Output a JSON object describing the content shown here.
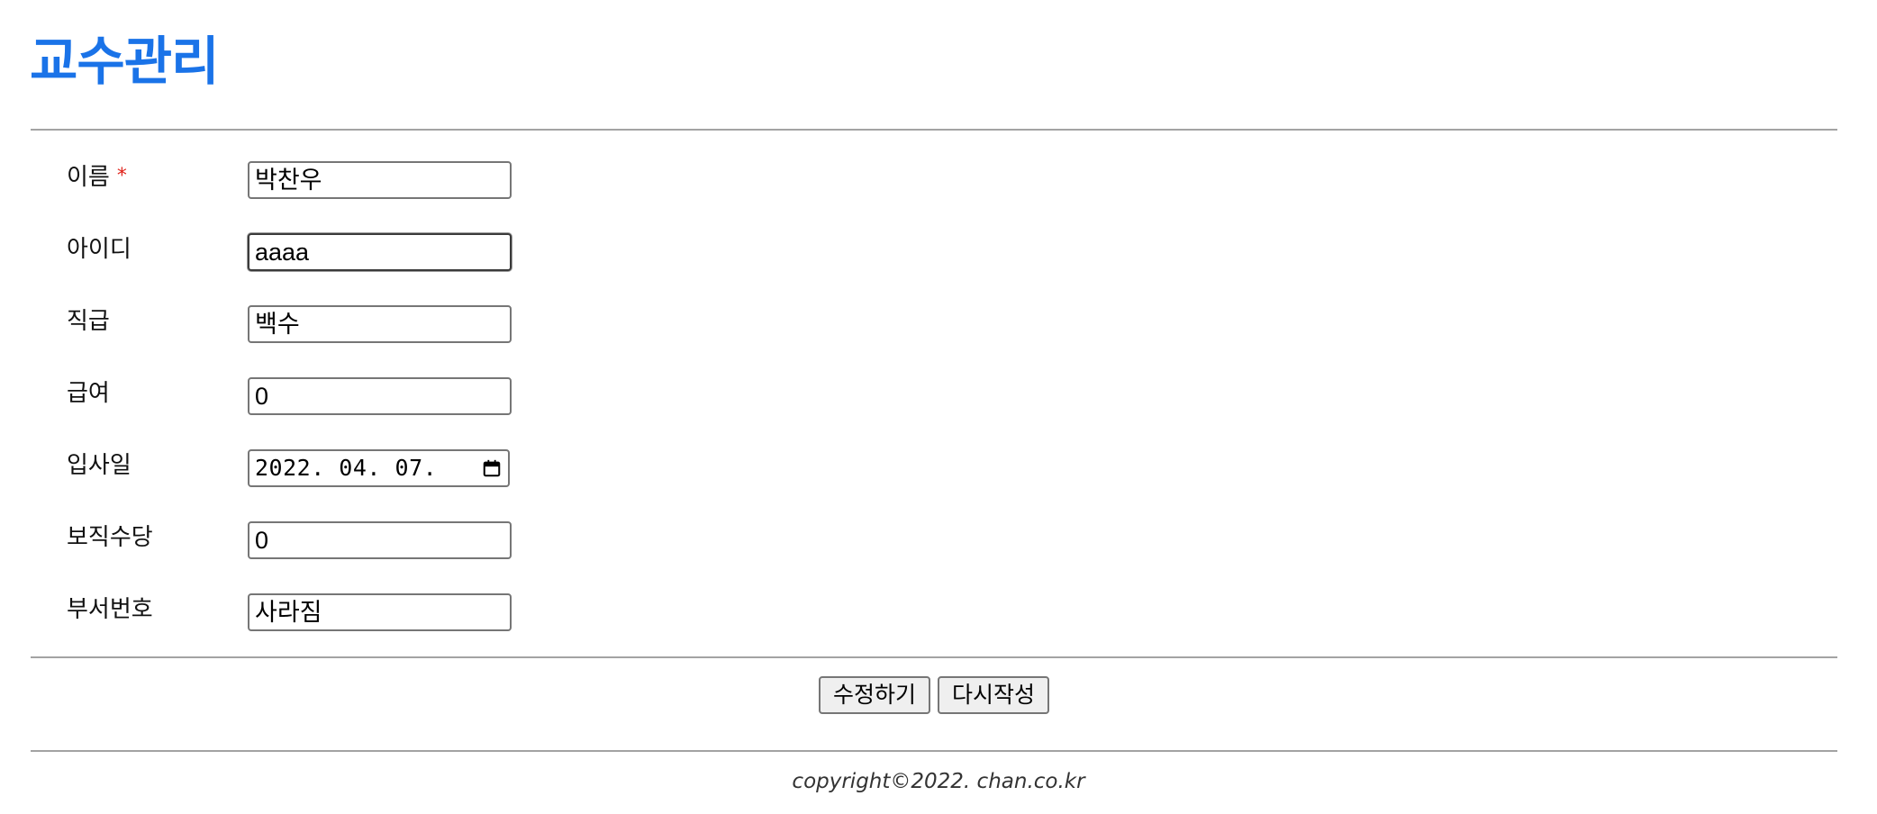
{
  "page": {
    "title": "교수관리"
  },
  "form": {
    "required_mark": "*",
    "fields": [
      {
        "label": "이름",
        "value": "박찬우",
        "required": true
      },
      {
        "label": "아이디",
        "value": "aaaa"
      },
      {
        "label": "직급",
        "value": "백수"
      },
      {
        "label": "급여",
        "value": "0"
      },
      {
        "label": "입사일",
        "value": "2022. 04. 07.",
        "type": "date"
      },
      {
        "label": "보직수당",
        "value": "0"
      },
      {
        "label": "부서번호",
        "value": "사라짐"
      }
    ]
  },
  "actions": {
    "submit_label": "수정하기",
    "reset_label": "다시작성"
  },
  "footer": {
    "copyright": "copyright©2022. chan.co.kr"
  },
  "colors": {
    "title": "#1a73e8",
    "required": "#e0231b",
    "divider": "#a3a3a3"
  }
}
